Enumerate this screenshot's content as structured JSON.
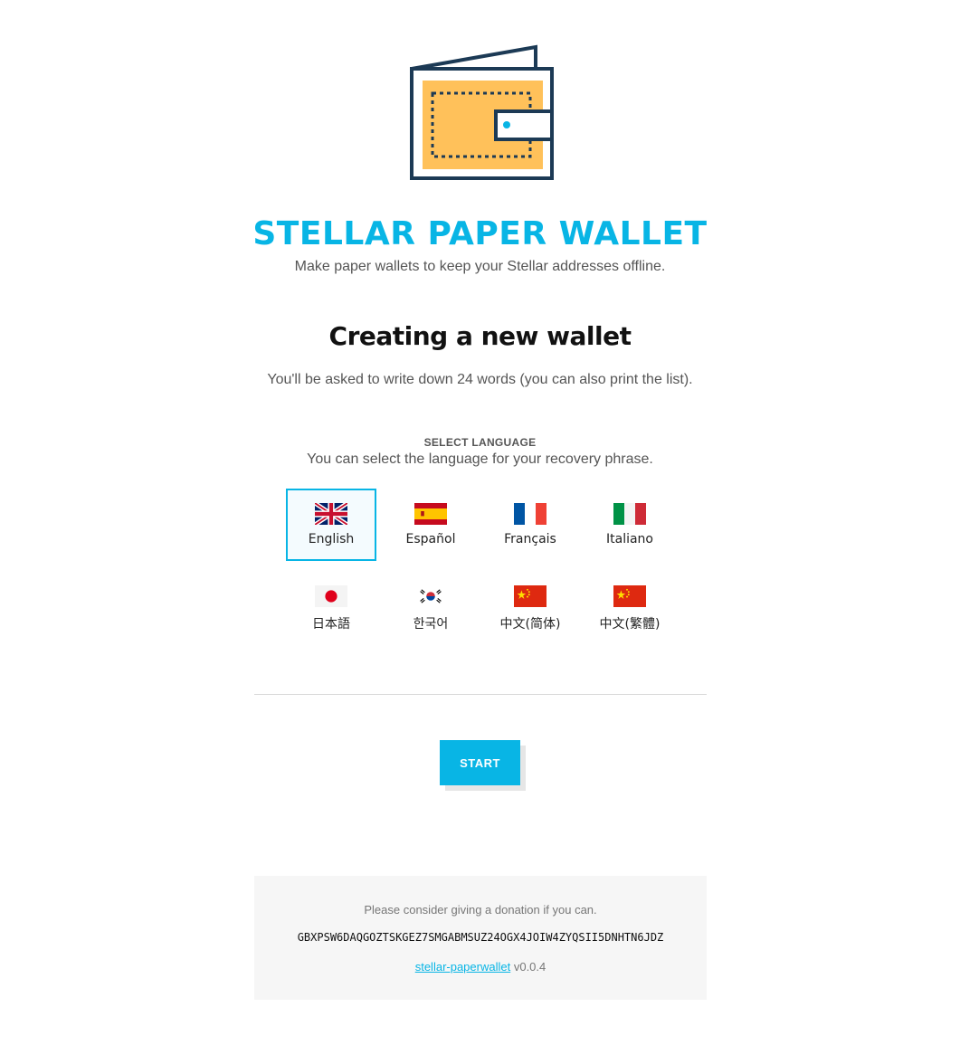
{
  "header": {
    "logo_icon": "wallet-icon",
    "title": "STELLAR PAPER WALLET",
    "subtitle": "Make paper wallets to keep your Stellar addresses offline."
  },
  "create": {
    "title": "Creating a new wallet",
    "description": "You'll be asked to write down 24 words (you can also print the list)."
  },
  "language": {
    "heading": "SELECT LANGUAGE",
    "description": "You can select the language for your recovery phrase.",
    "selected": "English",
    "options": [
      {
        "label": "English",
        "flag": "uk-flag-icon"
      },
      {
        "label": "Español",
        "flag": "spain-flag-icon"
      },
      {
        "label": "Français",
        "flag": "france-flag-icon"
      },
      {
        "label": "Italiano",
        "flag": "italy-flag-icon"
      },
      {
        "label": "日本語",
        "flag": "japan-flag-icon"
      },
      {
        "label": "한국어",
        "flag": "korea-flag-icon"
      },
      {
        "label": "中文(简体)",
        "flag": "china-flag-icon"
      },
      {
        "label": "中文(繁體)",
        "flag": "china-flag-icon"
      }
    ]
  },
  "actions": {
    "start_label": "START"
  },
  "footer": {
    "donation_note": "Please consider giving a donation if you can.",
    "donation_address": "GBXPSW6DAQGOZTSKGEZ7SMGABMSUZ24OGX4JOIW4ZYQSII5DNHTN6JDZ",
    "project_link": "stellar-paperwallet",
    "version": "v0.0.4"
  },
  "colors": {
    "accent": "#08b5e5",
    "wallet_fill": "#ffc15a",
    "wallet_outline": "#1c3a55"
  }
}
